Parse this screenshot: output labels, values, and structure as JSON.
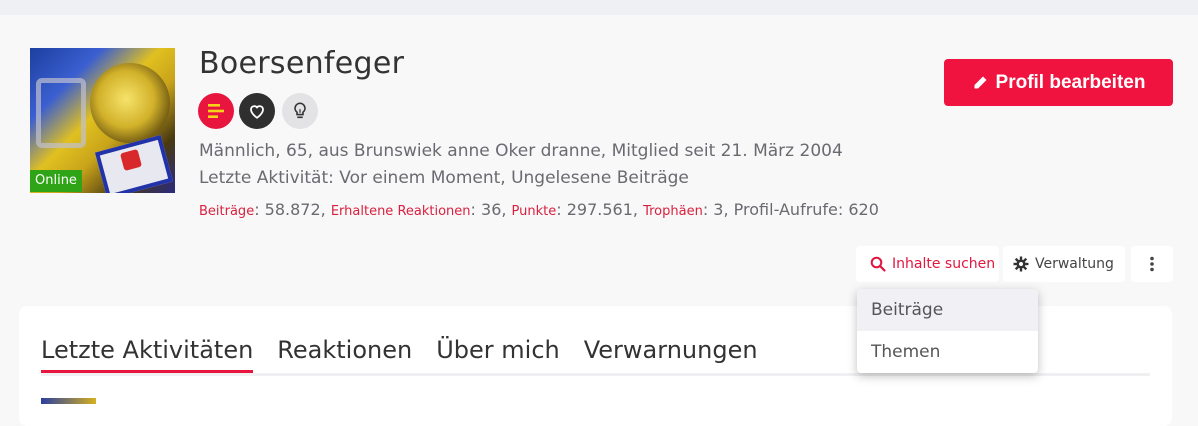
{
  "profile": {
    "username": "Boersenfeger",
    "online_label": "Online",
    "info_line": "Männlich, 65, aus Brunswiek anne Oker dranne, Mitglied seit 21. März 2004",
    "activity_line": "Letzte Aktivität: Vor einem Moment, Ungelesene Beiträge",
    "stats": {
      "posts_label": "Beiträge",
      "posts_value": ": 58.872, ",
      "reactions_label": "Erhaltene Reaktionen",
      "reactions_value": ": 36, ",
      "points_label": "Punkte",
      "points_value": ": 297.561, ",
      "trophies_label": "Trophäen",
      "trophies_value": ": 3, Profil-Aufrufe: 620"
    },
    "badges": [
      "posts-badge-icon",
      "heart-badge-icon",
      "lightbulb-badge-icon"
    ]
  },
  "actions": {
    "edit_profile": "Profil bearbeiten",
    "search_content": "Inhalte suchen",
    "management": "Verwaltung"
  },
  "dropdown": {
    "items": [
      "Beiträge",
      "Themen"
    ]
  },
  "tabs": [
    "Letzte Aktivitäten",
    "Reaktionen",
    "Über mich",
    "Verwarnungen"
  ],
  "colors": {
    "accent": "#f0133f",
    "online": "#2ea416",
    "badge_dark": "#2f2f2f",
    "badge_light": "#e3e3e6"
  }
}
